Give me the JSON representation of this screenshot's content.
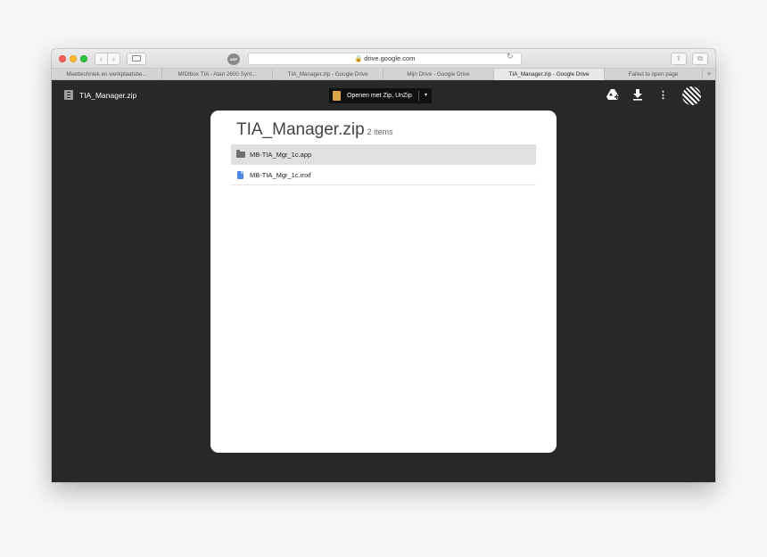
{
  "browser": {
    "url": "drive.google.com",
    "icons": {
      "back": "chevron-left-icon",
      "forward": "chevron-right-icon",
      "sidebar": "sidebar-icon",
      "extension": "adblock-icon",
      "reload": "reload-icon",
      "share": "share-icon",
      "tabs": "tabs-overview-icon"
    },
    "extension_label": "ABP",
    "tabs": [
      {
        "label": "Meettechniek en werkplaatsbe...",
        "active": false
      },
      {
        "label": "MIDIbox TIA - Atari 2600 Synt...",
        "active": false
      },
      {
        "label": "TIA_Manager.zip - Google Drive",
        "active": false
      },
      {
        "label": "Mijn Drive - Google Drive",
        "active": false
      },
      {
        "label": "TIA_Manager.zip - Google Drive",
        "active": true
      },
      {
        "label": "Failed to open page",
        "active": false
      }
    ],
    "new_tab": "+"
  },
  "drive": {
    "file_title": "TIA_Manager.zip",
    "open_with": {
      "label": "Openen met Zip, UnZip",
      "caret": "▾"
    },
    "actions": {
      "add_to_drive": "add-to-drive-icon",
      "download": "download-icon",
      "more": "more-vert-icon"
    }
  },
  "viewer": {
    "title": "TIA_Manager.zip",
    "item_count": "2 items",
    "items": [
      {
        "name": "MB-TIA_Mgr_1c.app",
        "icon": "folder-icon",
        "selected": true
      },
      {
        "name": "MB-TIA_Mgr_1c.mxf",
        "icon": "document-icon",
        "selected": false
      }
    ]
  },
  "colors": {
    "window_background": "#282828",
    "viewer_background": "#ffffff",
    "selected_row": "#e0e0e0",
    "document_icon": "#4a86e8"
  }
}
